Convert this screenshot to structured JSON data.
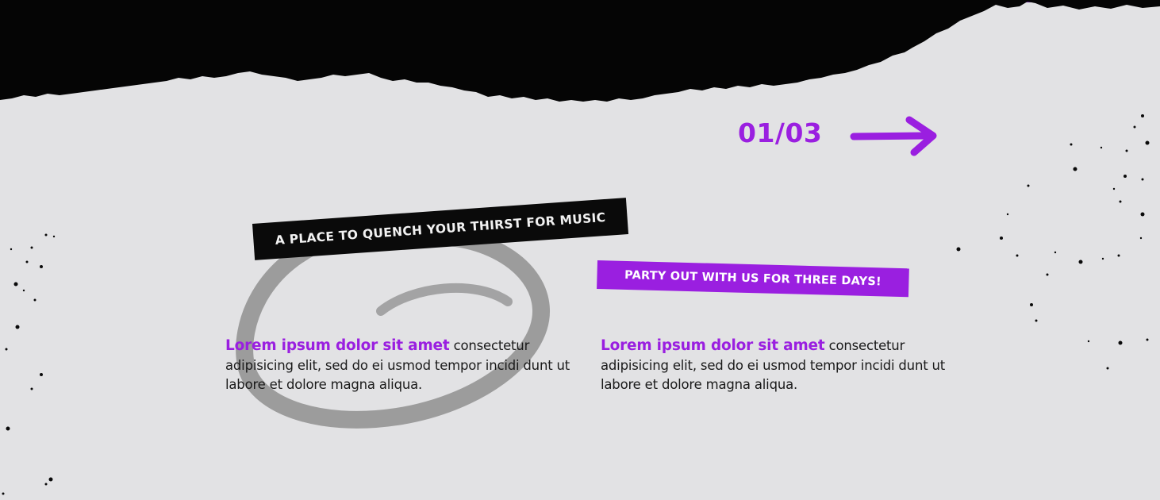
{
  "slider": {
    "counter": "01/03"
  },
  "tags": {
    "black": "A PLACE TO QUENCH YOUR THIRST FOR MUSIC",
    "purple": "PARTY OUT WITH US FOR THREE DAYS!"
  },
  "columns": [
    {
      "highlight": "Lorem ipsum dolor sit amet",
      "body": " consectetur adipisicing elit, sed do ei usmod tempor incidi dunt ut labore et dolore magna aliqua."
    },
    {
      "highlight": "Lorem ipsum dolor sit amet",
      "body": " consectetur adipisicing elit, sed do ei usmod tempor incidi dunt ut labore et dolore magna aliqua."
    }
  ],
  "colors": {
    "accent": "#9a1fe0",
    "background": "#e2e2e4",
    "dark": "#0a0a0a"
  },
  "icons": {
    "next": "arrow-right-icon",
    "decor": "circle-scribble-icon"
  }
}
